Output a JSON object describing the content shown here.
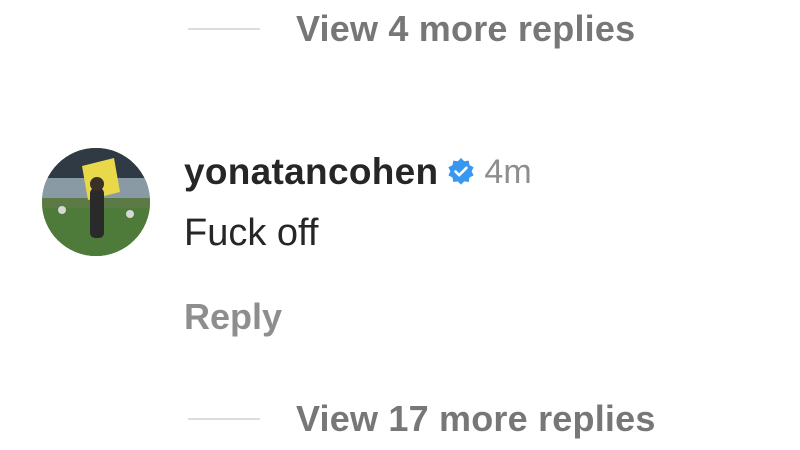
{
  "view_more_top": {
    "label": "View 4 more replies"
  },
  "comment": {
    "username": "yonatancohen",
    "verified_icon": "verified-badge-icon",
    "time": "4m",
    "text": "Fuck off",
    "reply_label": "Reply"
  },
  "view_more_bottom": {
    "label": "View 17 more replies"
  },
  "colors": {
    "username": "#262626",
    "muted": "#8e8e8e",
    "verified": "#3897f0",
    "rule": "#dcdcdc"
  }
}
